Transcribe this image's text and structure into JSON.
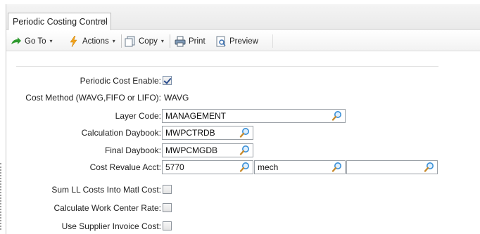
{
  "tab": {
    "title": "Periodic Costing Control",
    "close": "×"
  },
  "toolbar": {
    "goto_label": "Go To",
    "actions_label": "Actions",
    "copy_label": "Copy",
    "print_label": "Print",
    "preview_label": "Preview",
    "caret": "▾"
  },
  "form": {
    "periodic_cost_enable": {
      "label": "Periodic Cost Enable:",
      "checked": true
    },
    "cost_method": {
      "label": "Cost Method (WAVG,FIFO or LIFO):",
      "value": "WAVG"
    },
    "layer_code": {
      "label": "Layer Code:",
      "value": "MANAGEMENT"
    },
    "calculation_daybook": {
      "label": "Calculation Daybook:",
      "value": "MWPCTRDB"
    },
    "final_daybook": {
      "label": "Final Daybook:",
      "value": "MWPCMGDB"
    },
    "cost_revalue_acct": {
      "label": "Cost Revalue Acct:",
      "value1": "5770",
      "value2": "mech",
      "value3": ""
    },
    "sum_ll_costs": {
      "label": "Sum LL Costs Into Matl Cost:",
      "checked": false
    },
    "calc_work_center_rate": {
      "label": "Calculate Work Center Rate:",
      "checked": false
    },
    "use_supplier_invoice_cost": {
      "label": "Use Supplier Invoice Cost:",
      "checked": false
    }
  },
  "icons": {
    "goto": "green-arrow-icon",
    "actions": "lightning-icon",
    "copy": "copy-icon",
    "print": "printer-icon",
    "preview": "preview-icon",
    "lookup": "magnifier-icon"
  },
  "colors": {
    "checkmark": "#2a4d8f",
    "goto_arrow": "#2e9a2e",
    "actions_bolt": "#f2a31b",
    "magnifier": "#3a8fd6"
  }
}
